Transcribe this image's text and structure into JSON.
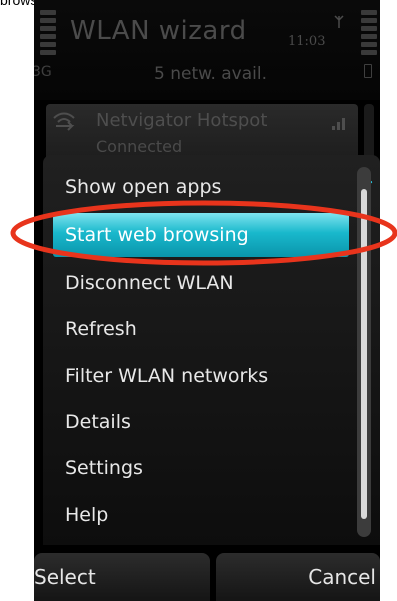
{
  "caption": "browsing",
  "header": {
    "title": "WLAN wizard",
    "clock": "11:03",
    "network_type": "3G",
    "networks_available": "5 netw. avail."
  },
  "background_item": {
    "name": "Netvigator Hotspot",
    "status": "Connected"
  },
  "menu": {
    "items": [
      {
        "label": "Show open apps"
      },
      {
        "label": "Start web browsing"
      },
      {
        "label": "Disconnect WLAN"
      },
      {
        "label": "Refresh"
      },
      {
        "label": "Filter WLAN networks"
      },
      {
        "label": "Details"
      },
      {
        "label": "Settings"
      },
      {
        "label": "Help"
      }
    ],
    "selected_index": 1
  },
  "softkeys": {
    "left": "Select",
    "right": "Cancel"
  },
  "colors": {
    "selection": "#19b8cc",
    "highlight_annotation": "#e8341c"
  },
  "icons": {
    "wifi": "wifi-icon",
    "apps": "open-apps-icon",
    "signal": "signal-strength-icon",
    "battery": "battery-icon"
  }
}
